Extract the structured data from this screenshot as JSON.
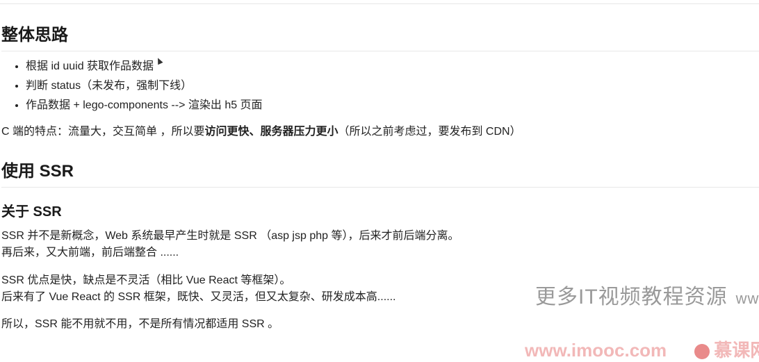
{
  "sections": {
    "overall": {
      "title": "整体思路",
      "bullets": [
        "根据 id uuid 获取作品数据",
        "判断 status（未发布，强制下线）",
        "作品数据 + lego-components --> 渲染出 h5 页面"
      ],
      "c_side_prefix": "C 端的特点：流量大，交互简单 ，所以要",
      "c_side_bold": "访问更快、服务器压力更小",
      "c_side_suffix": "（所以之前考虑过，要发布到 CDN）"
    },
    "ssr": {
      "title": "使用 SSR",
      "about_title": "关于 SSR",
      "para1_line1": "SSR 并不是新概念，Web 系统最早产生时就是 SSR （asp jsp php 等），后来才前后端分离。",
      "para1_line2": "再后来，又大前端，前后端整合 ......",
      "para2_line1": "SSR 优点是快，缺点是不灵活（相比 Vue React 等框架）。",
      "para2_line2": "后来有了 Vue React 的 SSR 框架，既快、又灵活，但又太复杂、研发成本高......",
      "para3": "所以，SSR 能不用就不用，不是所有情况都适用 SSR 。"
    }
  },
  "watermark": {
    "text": "更多IT视频教程资源",
    "www": "www",
    "site": "www.imooc.com",
    "brand": "慕课网"
  },
  "colors": {
    "text": "#222222",
    "rule": "#e8e8e8",
    "watermark": "#9a9a9a",
    "brand": "#e98a8a"
  }
}
